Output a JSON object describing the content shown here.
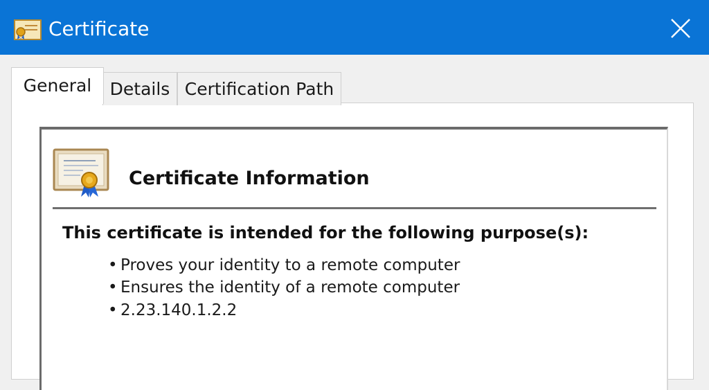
{
  "window": {
    "title": "Certificate",
    "icon": "certificate-icon",
    "close_icon": "close-icon",
    "titlebar_color": "#0a74d6"
  },
  "tabs": [
    {
      "label": "General",
      "active": true
    },
    {
      "label": "Details",
      "active": false
    },
    {
      "label": "Certification Path",
      "active": false
    }
  ],
  "info": {
    "heading": "Certificate Information",
    "icon": "certificate-icon",
    "purpose_heading": "This certificate is intended for the following purpose(s):",
    "purposes": [
      "Proves your identity to a remote computer",
      "Ensures the identity of a remote computer",
      "2.23.140.1.2.2"
    ],
    "bullet": "•"
  }
}
